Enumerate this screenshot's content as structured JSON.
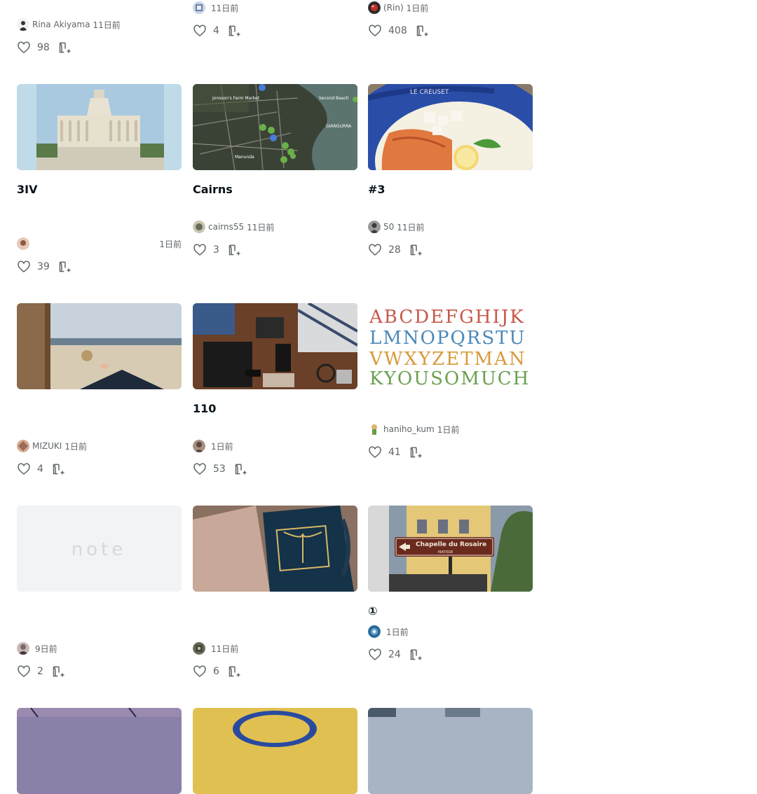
{
  "articles": [
    {
      "title": "",
      "author": "Rina Akiyama",
      "age": "11日前",
      "likes": "98",
      "avatar_color": "#3a3230"
    },
    {
      "title": "",
      "author": "",
      "age": "11日前",
      "likes": "4",
      "avatar_color": "#6b7fa8"
    },
    {
      "title": "",
      "author": "(Rin)",
      "age": "1日前",
      "likes": "408",
      "avatar_color": "#c0302c"
    },
    {
      "title": "3IV",
      "author": "",
      "age": "1日前",
      "likes": "39",
      "avatar_color": "#8a5a44"
    },
    {
      "title": "Cairns",
      "author": "cairns55",
      "age": "11日前",
      "likes": "3",
      "avatar_color": "#6a6a5a"
    },
    {
      "title": "#3",
      "author": "50",
      "age": "11日前",
      "likes": "28",
      "avatar_color": "#3c3c3c"
    },
    {
      "title": "",
      "author": "MIZUKI",
      "age": "1日前",
      "likes": "4",
      "avatar_color": "#9a6a5a"
    },
    {
      "title": "110",
      "author": "",
      "age": "1日前",
      "likes": "53",
      "avatar_color": "#5a4a44"
    },
    {
      "title": "",
      "author": "haniho_kum",
      "age": "1日前",
      "likes": "41",
      "avatar_color": "#d9b86a"
    },
    {
      "title": "",
      "author": "",
      "age": "9日前",
      "likes": "2",
      "avatar_color": "#7a6a6a"
    },
    {
      "title": "",
      "author": "",
      "age": "11日前",
      "likes": "6",
      "avatar_color": "#4a4a3a"
    },
    {
      "title": "①",
      "author": "",
      "age": "1日前",
      "likes": "24",
      "avatar_color": "#2a6a9a"
    }
  ],
  "placeholder_logo": "note",
  "sign": {
    "name": "Chapelle du Rosaire",
    "sub": "MATISSE"
  },
  "pot_brand": "LE CREUSET",
  "map_labels": {
    "farm": "Jonsson's Farm Market",
    "beach": "Second Beach",
    "town": "Manunda",
    "area": "GIANGURRA"
  }
}
